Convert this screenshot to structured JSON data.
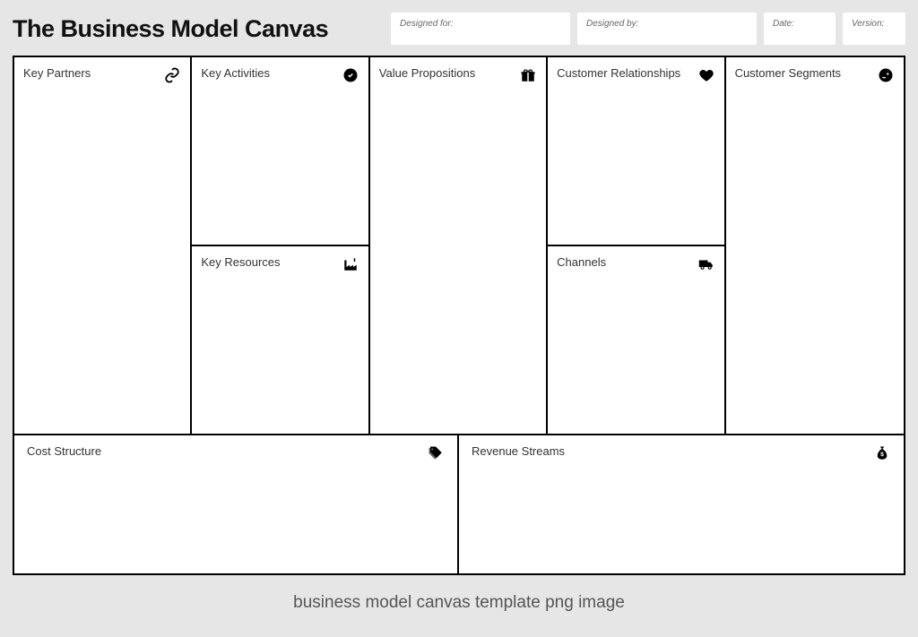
{
  "title": "The Business Model Canvas",
  "meta": {
    "designed_for_label": "Designed for:",
    "designed_by_label": "Designed by:",
    "date_label": "Date:",
    "version_label": "Version:"
  },
  "blocks": {
    "key_partners": "Key Partners",
    "key_activities": "Key Activities",
    "key_resources": "Key Resources",
    "value_propositions": "Value Propositions",
    "customer_relationships": "Customer Relationships",
    "channels": "Channels",
    "customer_segments": "Customer Segments",
    "cost_structure": "Cost Structure",
    "revenue_streams": "Revenue Streams"
  },
  "caption": "business model canvas template png image",
  "icons": {
    "key_partners": "link-icon",
    "key_activities": "checkmark-circle-icon",
    "key_resources": "factory-icon",
    "value_propositions": "gift-icon",
    "customer_relationships": "heart-icon",
    "channels": "truck-icon",
    "customer_segments": "person-icon",
    "cost_structure": "price-tag-icon",
    "revenue_streams": "money-bag-icon"
  }
}
